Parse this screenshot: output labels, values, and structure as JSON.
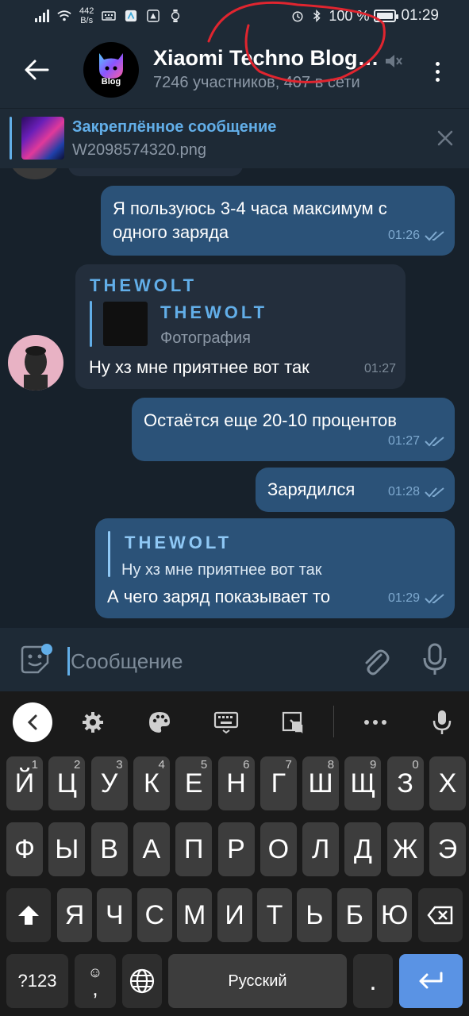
{
  "status_bar": {
    "time": "01:29",
    "net_speed": "442",
    "net_unit": "B/s",
    "battery": "100 %",
    "battery_level": 1.0
  },
  "header": {
    "title": "Xiaomi Techno Blog…",
    "subtitle": "7246 участников, 407 в сети",
    "avatar_text": "Blog"
  },
  "pinned": {
    "title": "Закреплённое сообщение",
    "text": "W2098574320.png"
  },
  "messages": [
    {
      "direction": "out",
      "text": "Я пользуюсь 3-4 часа максимум с одного заряда",
      "time": "01:26",
      "read": true
    },
    {
      "direction": "in",
      "sender": "THEWOLT",
      "reply_name": "THEWOLT",
      "reply_text": "Фотография",
      "text": "Ну хз мне приятнее вот так",
      "time": "01:27"
    },
    {
      "direction": "out",
      "text": "Остаётся еще 20-10 процентов",
      "time": "01:27",
      "read": true
    },
    {
      "direction": "out",
      "text": "Зарядился",
      "time": "01:28",
      "read": true
    },
    {
      "direction": "out",
      "reply_name": "THEWOLT",
      "reply_text": "Ну хз мне приятнее вот так",
      "text": "А чего заряд показывает то",
      "time": "01:29",
      "read": true
    }
  ],
  "input": {
    "placeholder": "Сообщение"
  },
  "keyboard": {
    "rows": [
      [
        [
          "Й",
          "1"
        ],
        [
          "Ц",
          "2"
        ],
        [
          "У",
          "3"
        ],
        [
          "К",
          "4"
        ],
        [
          "Е",
          "5"
        ],
        [
          "Н",
          "6"
        ],
        [
          "Г",
          "7"
        ],
        [
          "Ш",
          "8"
        ],
        [
          "Щ",
          "9"
        ],
        [
          "З",
          "0"
        ],
        [
          "Х",
          ""
        ]
      ],
      [
        [
          "Ф",
          ""
        ],
        [
          "Ы",
          ""
        ],
        [
          "В",
          ""
        ],
        [
          "А",
          ""
        ],
        [
          "П",
          ""
        ],
        [
          "Р",
          ""
        ],
        [
          "О",
          ""
        ],
        [
          "Л",
          ""
        ],
        [
          "Д",
          ""
        ],
        [
          "Ж",
          ""
        ],
        [
          "Э",
          ""
        ]
      ],
      [
        [
          "Я",
          ""
        ],
        [
          "Ч",
          ""
        ],
        [
          "С",
          ""
        ],
        [
          "М",
          ""
        ],
        [
          "И",
          ""
        ],
        [
          "Т",
          ""
        ],
        [
          "Ь",
          ""
        ],
        [
          "Б",
          ""
        ],
        [
          "Ю",
          ""
        ]
      ]
    ],
    "num_key": "?123",
    "emoji_comma": ",",
    "space_label": "Русский",
    "period": "."
  },
  "colors": {
    "accent": "#62aee8",
    "out_bubble": "#2b5278",
    "in_bubble": "#232e3c",
    "enter_key": "#5a93e4"
  }
}
